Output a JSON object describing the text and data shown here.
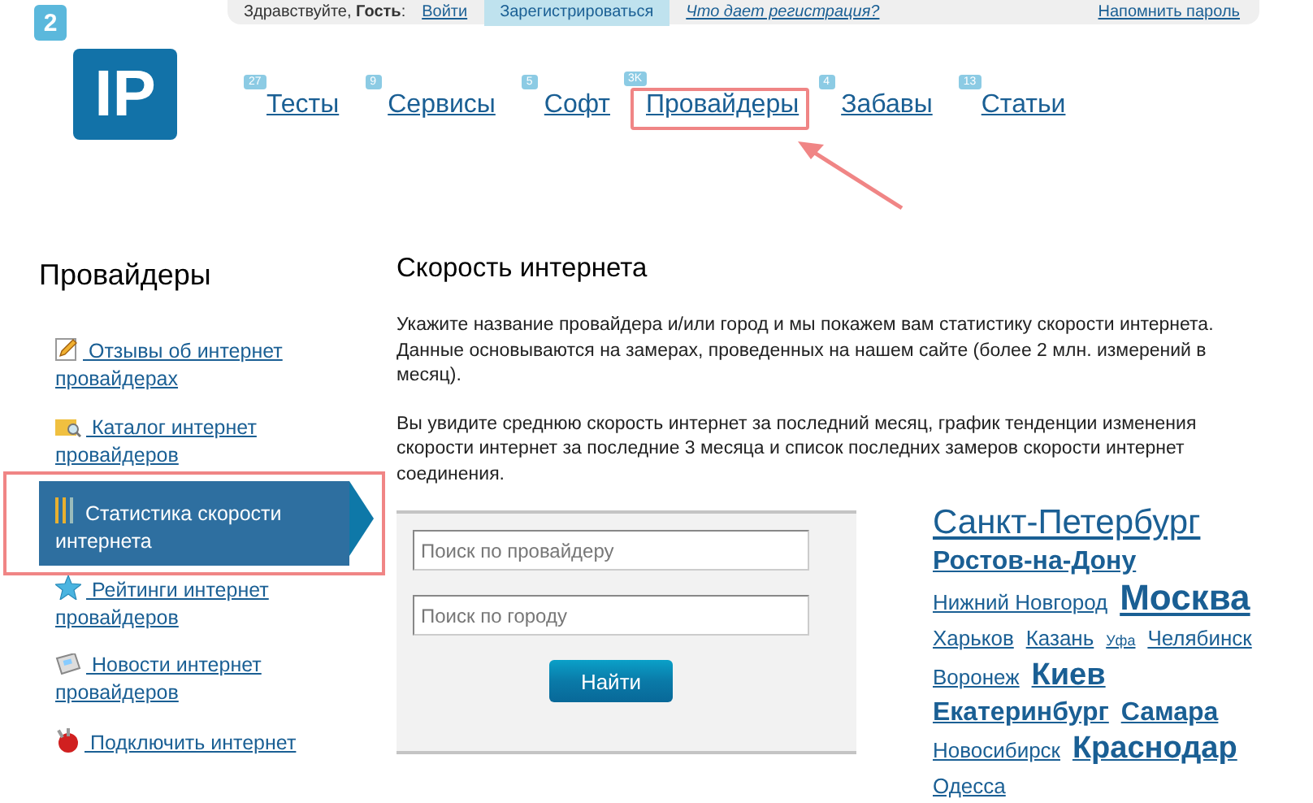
{
  "top_bar": {
    "greeting": "Здравствуйте, **Гость**:",
    "login": "Войти",
    "register": "Зарегистрироваться",
    "why_register": "Что дает регистрация?",
    "remind_password": "Напомнить пароль"
  },
  "logo": {
    "small": "2",
    "large": "IP"
  },
  "nav": [
    {
      "label": "Тесты",
      "badge": "27",
      "highlighted": false
    },
    {
      "label": "Сервисы",
      "badge": "9",
      "highlighted": false
    },
    {
      "label": "Софт",
      "badge": "5",
      "highlighted": false
    },
    {
      "label": "Провайдеры",
      "badge": "3K",
      "highlighted": true
    },
    {
      "label": "Забавы",
      "badge": "4",
      "highlighted": false
    },
    {
      "label": "Статьи",
      "badge": "13",
      "highlighted": false
    }
  ],
  "sidebar": {
    "title": "Провайдеры",
    "items": [
      {
        "label": "Отзывы об интернет провайдерах",
        "selected": false,
        "highlighted": false
      },
      {
        "label": "Каталог интернет провайдеров",
        "selected": false,
        "highlighted": false
      },
      {
        "label": "Статистика скорости интернета",
        "selected": true,
        "highlighted": true
      },
      {
        "label": "Рейтинги интернет провайдеров",
        "selected": false,
        "highlighted": false
      },
      {
        "label": "Новости интернет провайдеров",
        "selected": false,
        "highlighted": false
      },
      {
        "label": "Подключить интернет",
        "selected": false,
        "highlighted": false
      }
    ]
  },
  "main": {
    "title": "Скорость интернета",
    "paragraphs": [
      "Укажите название провайдера и/или город и мы покажем вам статистику скорости интернета. Данные основываются на замерах, проведенных на нашем сайте (более 2 млн. измерений в месяц).",
      "Вы увидите среднюю скорость интернет за последний месяц, график тенденции изменения скорости интернет за последние 3 месяца и список последних замеров скорости интернет соединения."
    ],
    "search": {
      "provider_placeholder": "Поиск по провайдеру",
      "city_placeholder": "Поиск по городу",
      "button": "Найти"
    },
    "cities": [
      {
        "name": "Санкт-Петербург",
        "kind": "huge"
      },
      {
        "name": "Ростов-на-Дону",
        "kind": "bold"
      },
      {
        "name": "Нижний Новгород",
        "kind": "small"
      },
      {
        "name": "Москва",
        "kind": "hugebold"
      },
      {
        "name": "Харьков",
        "kind": "small"
      },
      {
        "name": "Казань",
        "kind": "small"
      },
      {
        "name": "Уфа",
        "kind": "tiny"
      },
      {
        "name": "Челябинск",
        "kind": "small"
      },
      {
        "name": "Воронеж",
        "kind": "small"
      },
      {
        "name": "Киев",
        "kind": "bigbold"
      },
      {
        "name": "Екатеринбург",
        "kind": "bold"
      },
      {
        "name": "Самара",
        "kind": "bold"
      },
      {
        "name": "Новосибирск",
        "kind": "small"
      },
      {
        "name": "Краснодар",
        "kind": "bigbold"
      },
      {
        "name": "Одесса",
        "kind": "small"
      }
    ]
  }
}
